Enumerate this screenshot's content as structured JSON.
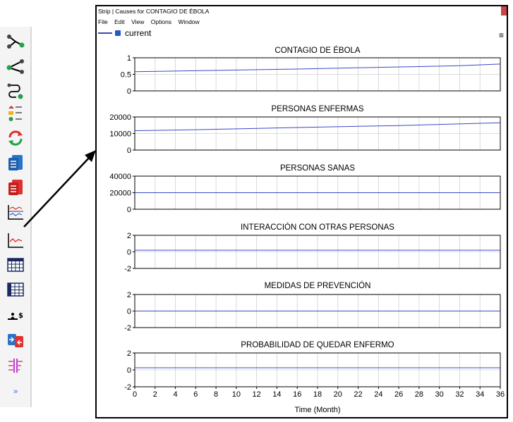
{
  "window": {
    "title": "Strip | Causes for CONTAGIO DE ÉBOLA",
    "menu": [
      "File",
      "Edit",
      "View",
      "Options",
      "Window"
    ],
    "legend_label": "current",
    "hamburger": "≡"
  },
  "toolbar": {
    "items": [
      {
        "icon": "causes-tree-icon"
      },
      {
        "icon": "uses-tree-icon"
      },
      {
        "icon": "loops-icon"
      },
      {
        "icon": "document-icon"
      },
      {
        "icon": "cycle-arrows-icon"
      },
      {
        "icon": "blue-document-icon"
      },
      {
        "icon": "red-document-icon"
      },
      {
        "icon": "strip-graph-icon"
      },
      {
        "icon": "graph-icon"
      },
      {
        "icon": "table-icon"
      },
      {
        "icon": "vertical-table-icon"
      },
      {
        "icon": "balance-icon"
      },
      {
        "icon": "compare-icon"
      },
      {
        "icon": "filter-icon"
      },
      {
        "icon": "more-icon",
        "label": "»"
      }
    ]
  },
  "colors": {
    "series": "#3a48c8",
    "grid": "#d0d0d0"
  },
  "chart_data": [
    {
      "type": "line",
      "title": "CONTAGIO DE ÉBOLA",
      "ylim": [
        0,
        1
      ],
      "yticks": [
        "1",
        "0.5",
        "0"
      ],
      "series": [
        {
          "name": "current",
          "x": [
            0,
            8,
            16,
            24,
            32,
            36
          ],
          "y": [
            0.58,
            0.62,
            0.66,
            0.71,
            0.76,
            0.81
          ]
        }
      ]
    },
    {
      "type": "line",
      "title": "PERSONAS ENFERMAS",
      "ylim": [
        0,
        20000
      ],
      "yticks": [
        "20000",
        "10000",
        "0"
      ],
      "series": [
        {
          "name": "current",
          "x": [
            0,
            6,
            16,
            26,
            36
          ],
          "y": [
            11700,
            12300,
            13600,
            14800,
            16500
          ]
        }
      ]
    },
    {
      "type": "line",
      "title": "PERSONAS SANAS",
      "ylim": [
        0,
        40000
      ],
      "yticks": [
        "40000",
        "20000",
        "0"
      ],
      "series": [
        {
          "name": "current",
          "x": [
            0,
            36
          ],
          "y": [
            20000,
            20000
          ]
        }
      ]
    },
    {
      "type": "line",
      "title": "INTERACCIÓN CON OTRAS PERSONAS",
      "ylim": [
        -2,
        2
      ],
      "yticks": [
        "2",
        "0",
        "-2"
      ],
      "series": [
        {
          "name": "current",
          "x": [
            0,
            36
          ],
          "y": [
            0.2,
            0.2
          ]
        }
      ]
    },
    {
      "type": "line",
      "title": "MEDIDAS DE PREVENCIÓN",
      "ylim": [
        -2,
        2
      ],
      "yticks": [
        "2",
        "0",
        "-2"
      ],
      "series": [
        {
          "name": "current",
          "x": [
            0,
            36
          ],
          "y": [
            0,
            0
          ]
        }
      ]
    },
    {
      "type": "line",
      "title": "PROBABILIDAD DE QUEDAR ENFERMO",
      "ylim": [
        -2,
        2
      ],
      "yticks": [
        "2",
        "0",
        "-2"
      ],
      "series": [
        {
          "name": "current",
          "x": [
            0,
            36
          ],
          "y": [
            0.25,
            0.25
          ]
        }
      ]
    }
  ],
  "x_axis": {
    "ticks": [
      "0",
      "2",
      "4",
      "6",
      "8",
      "10",
      "12",
      "14",
      "16",
      "18",
      "20",
      "22",
      "24",
      "26",
      "28",
      "30",
      "32",
      "34",
      "36"
    ],
    "xlim": [
      0,
      36
    ],
    "label": "Time (Month)"
  }
}
